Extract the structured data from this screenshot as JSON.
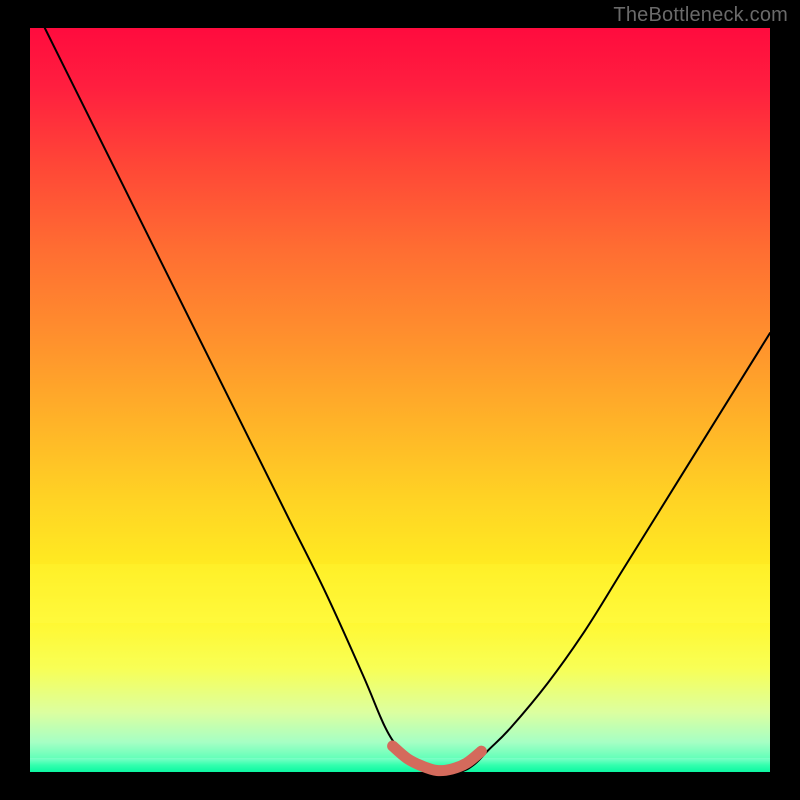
{
  "watermark": "TheBottleneck.com",
  "chart_data": {
    "type": "line",
    "title": "",
    "xlabel": "",
    "ylabel": "",
    "xlim": [
      0,
      100
    ],
    "ylim": [
      0,
      100
    ],
    "series": [
      {
        "name": "bottleneck-curve",
        "color": "#000000",
        "x": [
          2,
          5,
          10,
          15,
          20,
          25,
          30,
          35,
          40,
          45,
          48,
          50,
          52,
          55,
          58,
          60,
          62,
          65,
          70,
          75,
          80,
          85,
          90,
          95,
          100
        ],
        "values": [
          100,
          94,
          84,
          74,
          64,
          54,
          44,
          34,
          24,
          13,
          6,
          3,
          1,
          0,
          0,
          1,
          3,
          6,
          12,
          19,
          27,
          35,
          43,
          51,
          59
        ]
      }
    ],
    "highlight_segment": {
      "name": "optimal-range-marker",
      "color": "#d46a5c",
      "x": [
        49,
        51,
        53,
        55,
        57,
        59,
        61
      ],
      "values": [
        3.5,
        1.8,
        0.8,
        0.2,
        0.4,
        1.2,
        2.8
      ]
    },
    "pale_band": {
      "y_from": 20,
      "y_to": 28
    },
    "gradient_stops": [
      {
        "pos": 0,
        "color": "#ff0b3e"
      },
      {
        "pos": 30,
        "color": "#ff6e32"
      },
      {
        "pos": 63,
        "color": "#ffd224"
      },
      {
        "pos": 86,
        "color": "#f8ff55"
      },
      {
        "pos": 100,
        "color": "#2bffb0"
      }
    ]
  }
}
